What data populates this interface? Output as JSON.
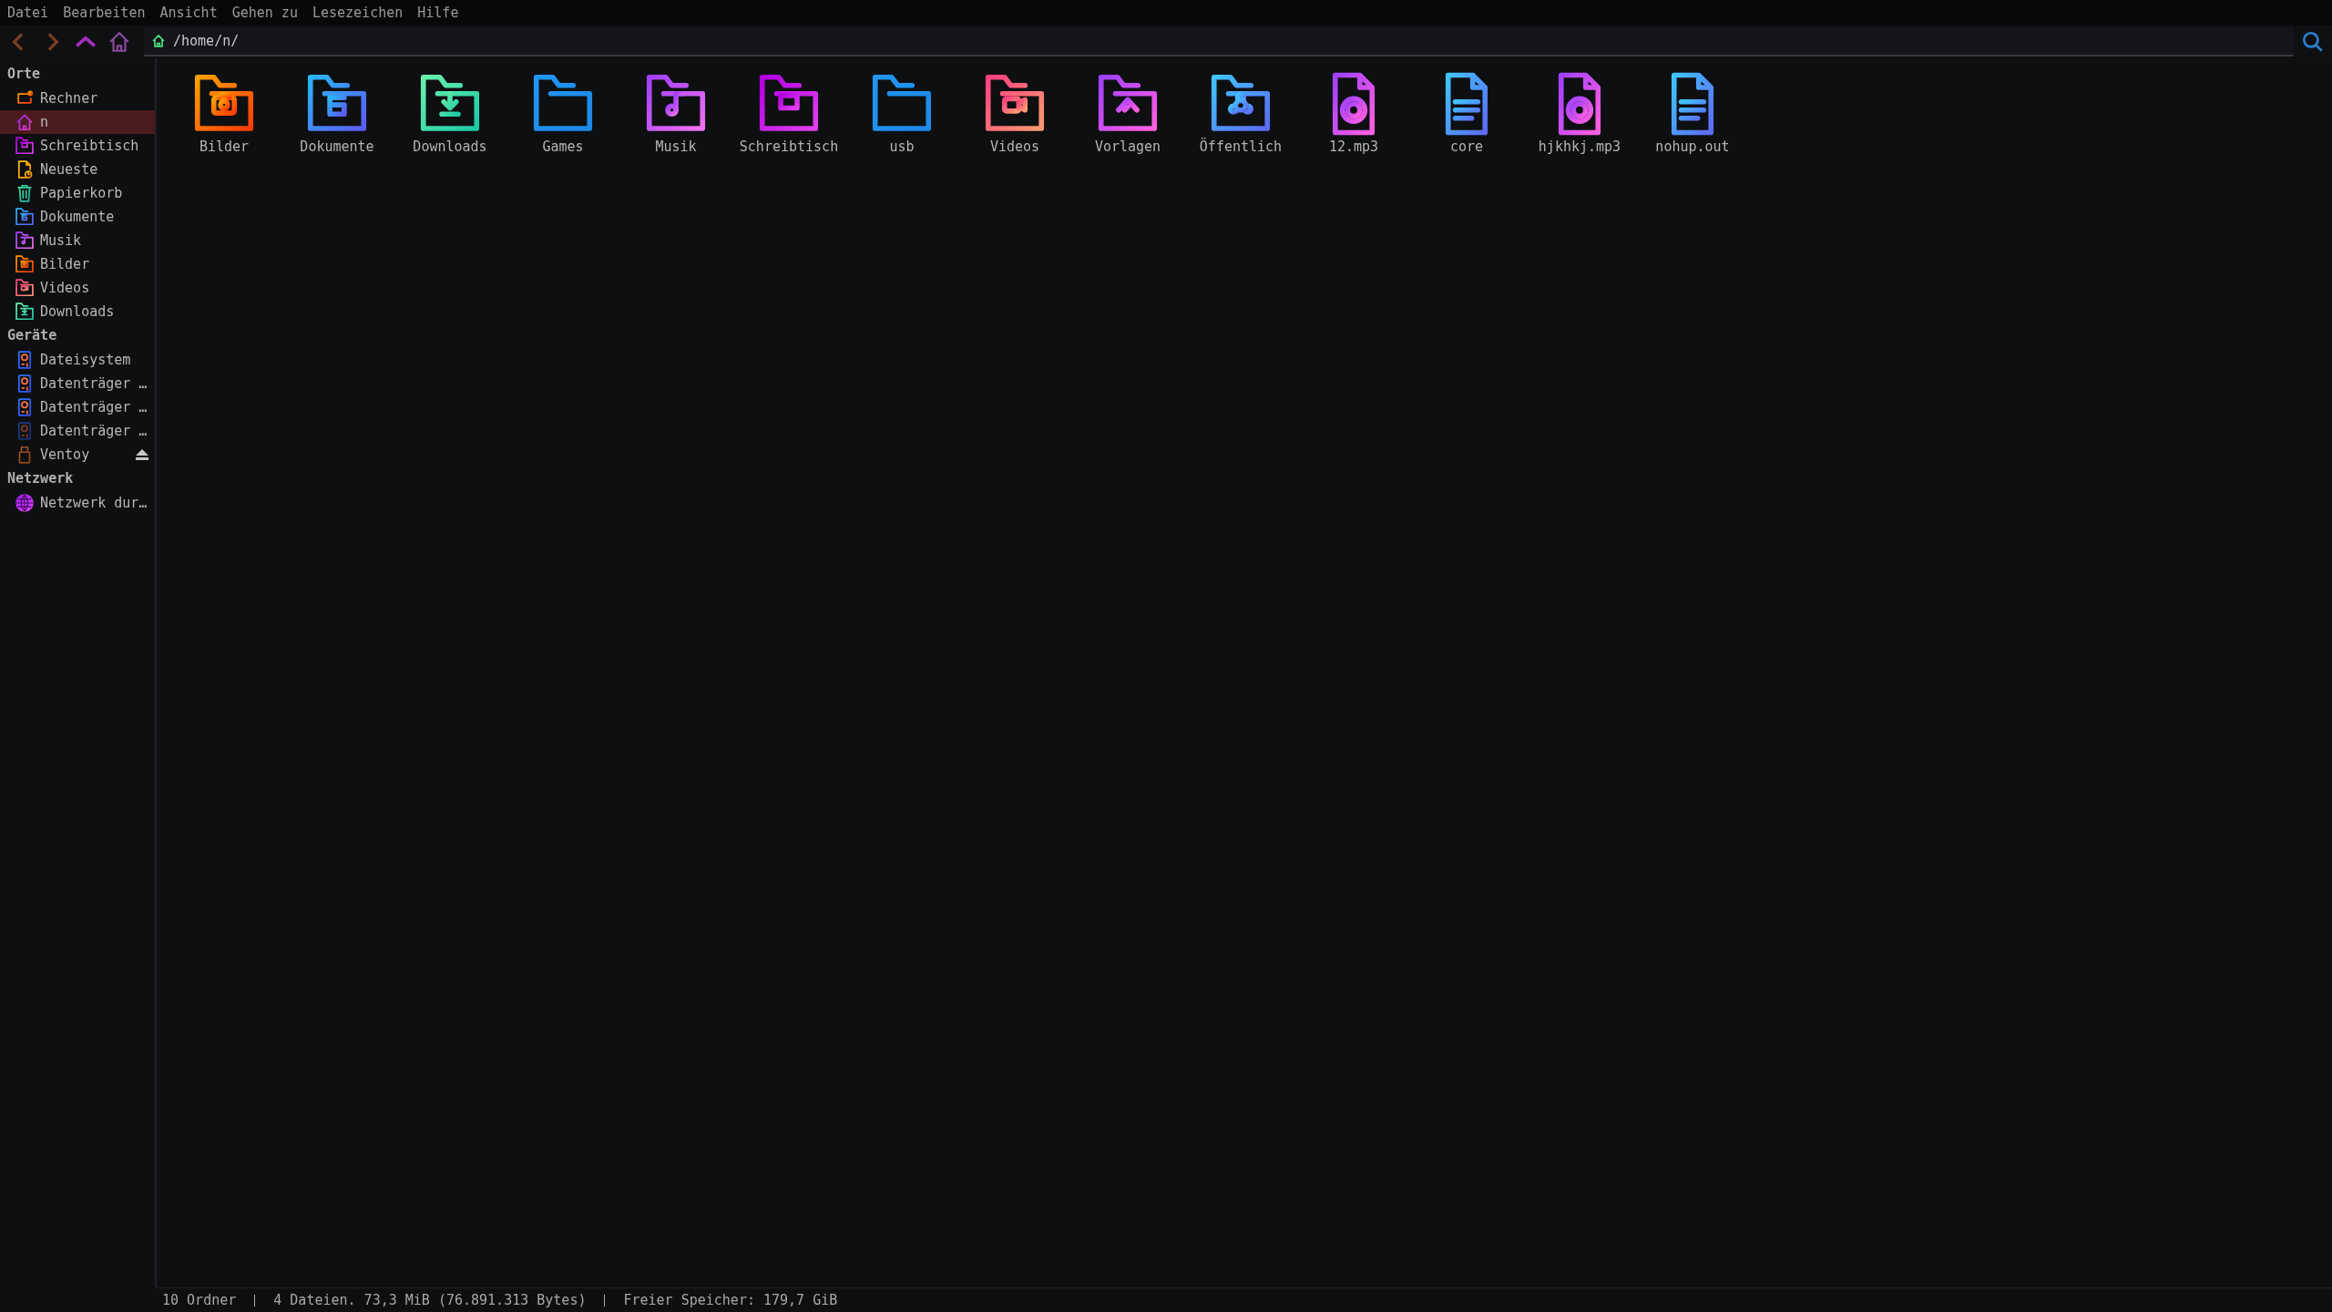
{
  "menu": [
    "Datei",
    "Bearbeiten",
    "Ansicht",
    "Gehen zu",
    "Lesezeichen",
    "Hilfe"
  ],
  "location": {
    "path": "/home/n/"
  },
  "sidebar": [
    {
      "heading": "Orte",
      "items": [
        {
          "label": "Rechner",
          "kind": "computer",
          "selected": false
        },
        {
          "label": "n",
          "kind": "home",
          "selected": true
        },
        {
          "label": "Schreibtisch",
          "kind": "desktop",
          "selected": false
        },
        {
          "label": "Neueste",
          "kind": "recent",
          "selected": false
        },
        {
          "label": "Papierkorb",
          "kind": "trash",
          "selected": false
        },
        {
          "label": "Dokumente",
          "kind": "documents",
          "selected": false
        },
        {
          "label": "Musik",
          "kind": "music",
          "selected": false
        },
        {
          "label": "Bilder",
          "kind": "pictures",
          "selected": false
        },
        {
          "label": "Videos",
          "kind": "videos",
          "selected": false
        },
        {
          "label": "Downloads",
          "kind": "downloads",
          "selected": false
        }
      ]
    },
    {
      "heading": "Geräte",
      "items": [
        {
          "label": "Dateisystem",
          "kind": "drive",
          "selected": false,
          "mounted": true
        },
        {
          "label": "Datenträger …",
          "kind": "drive",
          "selected": false,
          "mounted": true
        },
        {
          "label": "Datenträger …",
          "kind": "drive",
          "selected": false,
          "mounted": true
        },
        {
          "label": "Datenträger …",
          "kind": "drive",
          "selected": false,
          "mounted": false
        },
        {
          "label": "Ventoy",
          "kind": "usb",
          "selected": false,
          "mounted": true,
          "ejectable": true
        }
      ]
    },
    {
      "heading": "Netzwerk",
      "items": [
        {
          "label": "Netzwerk dur…",
          "kind": "network",
          "selected": false
        }
      ]
    }
  ],
  "files": [
    {
      "name": "Bilder",
      "kind": "pictures"
    },
    {
      "name": "Dokumente",
      "kind": "documents"
    },
    {
      "name": "Downloads",
      "kind": "downloads"
    },
    {
      "name": "Games",
      "kind": "folder"
    },
    {
      "name": "Musik",
      "kind": "music"
    },
    {
      "name": "Schreibtisch",
      "kind": "desktop"
    },
    {
      "name": "usb",
      "kind": "folder"
    },
    {
      "name": "Videos",
      "kind": "videos"
    },
    {
      "name": "Vorlagen",
      "kind": "templates"
    },
    {
      "name": "Öffentlich",
      "kind": "public"
    },
    {
      "name": "12.mp3",
      "kind": "audio"
    },
    {
      "name": "core",
      "kind": "text"
    },
    {
      "name": "hjkhkj.mp3",
      "kind": "audio"
    },
    {
      "name": "nohup.out",
      "kind": "text"
    }
  ],
  "status_bar": [
    "10 Ordner",
    "4 Dateien. 73,3 MiB (76.891.313 Bytes)",
    "Freier Speicher: 179,7 GiB"
  ]
}
